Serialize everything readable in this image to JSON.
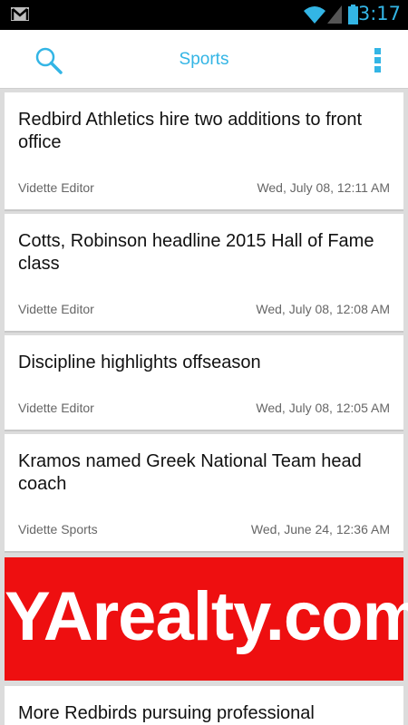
{
  "status_bar": {
    "time": "3:17",
    "icons": [
      "gmail-icon",
      "wifi-icon",
      "signal-icon",
      "battery-icon"
    ],
    "accent_color": "#33b5e5"
  },
  "action_bar": {
    "title": "Sports",
    "icons": [
      "search-icon",
      "overflow-menu-icon"
    ],
    "accent_color": "#33b5e5"
  },
  "articles": [
    {
      "headline": "Redbird Athletics hire two additions to front office",
      "author": "Vidette Editor",
      "date": "Wed, July 08, 12:11 AM"
    },
    {
      "headline": "Cotts, Robinson headline 2015 Hall of Fame class",
      "author": "Vidette Editor",
      "date": "Wed, July 08, 12:08 AM"
    },
    {
      "headline": "Discipline highlights offseason",
      "author": "Vidette Editor",
      "date": "Wed, July 08, 12:05 AM"
    },
    {
      "headline": "Kramos named Greek National Team head coach",
      "author": "Vidette Sports",
      "date": "Wed, June 24, 12:36 AM"
    },
    {
      "headline": "More Redbirds pursuing professional"
    }
  ],
  "ad": {
    "text": "YArealty.com",
    "background_color": "#ee0f10"
  }
}
